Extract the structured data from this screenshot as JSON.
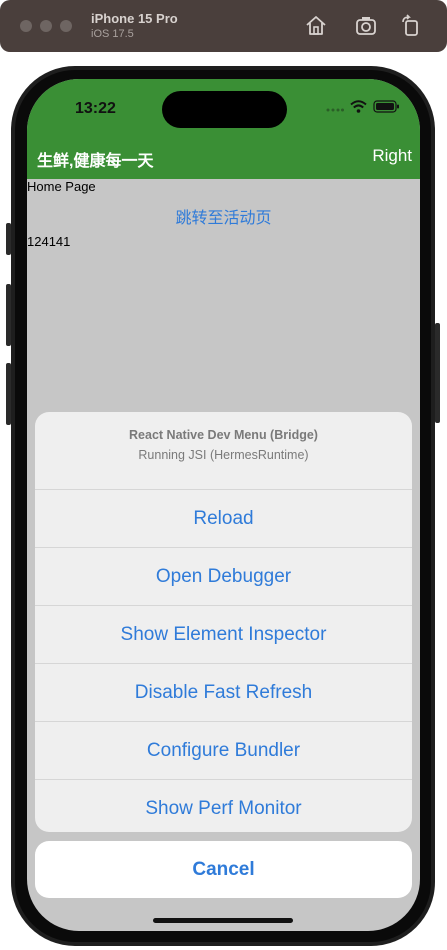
{
  "simulator": {
    "device_name": "iPhone 15 Pro",
    "os_version": "iOS 17.5",
    "toolbar_icons": [
      "home-icon",
      "screenshot-icon",
      "rotate-icon"
    ]
  },
  "status_bar": {
    "time": "13:22",
    "icons": [
      "signal-dots-icon",
      "wifi-icon",
      "battery-icon"
    ]
  },
  "nav": {
    "title": "生鲜,健康每一天",
    "right_label": "Right"
  },
  "content": {
    "home_label": "Home Page",
    "activity_link": "跳转至活动页",
    "number_text": "124141"
  },
  "dev_menu": {
    "title": "React Native Dev Menu (Bridge)",
    "subtitle": "Running JSI (HermesRuntime)",
    "items": [
      {
        "label": "Reload"
      },
      {
        "label": "Open Debugger"
      },
      {
        "label": "Show Element Inspector"
      },
      {
        "label": "Disable Fast Refresh"
      },
      {
        "label": "Configure Bundler"
      },
      {
        "label": "Show Perf Monitor"
      }
    ],
    "cancel_label": "Cancel"
  },
  "colors": {
    "header_green": "#3a8f35",
    "link_blue": "#2f7bd9",
    "sheet_bg": "#efefef",
    "toolbar_bg": "#4a3f3c"
  }
}
